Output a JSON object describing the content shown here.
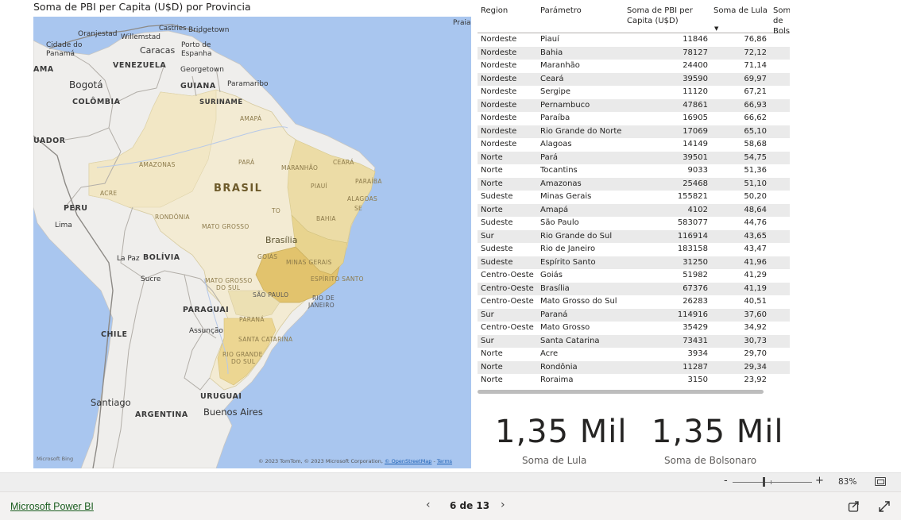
{
  "map": {
    "title": "Soma de PBI per Capita (U$D) por Provincia",
    "highlight_color": "#e8c973",
    "labels": {
      "country_brasil": "BRASIL",
      "country_venezuela": "VENEZUELA",
      "country_guiana": "GUIANA",
      "country_suriname": "SURINAME",
      "country_colombia": "COLÔMBIA",
      "country_equador": "UADOR",
      "country_peru": "PERU",
      "country_bolivia": "BOLÍVIA",
      "country_paraguai": "PARAGUAI",
      "country_chile": "CHILE",
      "country_argentina": "ARGENTINA",
      "country_uruguai": "URUGUAI",
      "city_oranjestad": "Oranjestad",
      "city_willemstad": "Willemstad",
      "city_castries": "Castries",
      "city_bridgetown": "Bridgetown",
      "city_cidade_panama_1": "Cidade do",
      "city_cidade_panama_2": "Panamá",
      "city_caracas": "Caracas",
      "city_porto_espanha_1": "Porto de",
      "city_porto_espanha_2": "Espanha",
      "city_georgetown": "Georgetown",
      "city_paramaribo": "Paramaribo",
      "city_bogota": "Bogotá",
      "city_lima": "Lima",
      "city_la_paz": "La Paz",
      "city_sucre": "Sucre",
      "city_assuncao": "Assunção",
      "city_santiago": "Santiago",
      "city_buenos_aires": "Buenos Aires",
      "city_brasilia": "Brasília",
      "city_praia": "Praia",
      "city_ama": "AMA",
      "state_amapa": "AMAPÁ",
      "state_amazonas": "AMAZONAS",
      "state_para": "PARÁ",
      "state_maranhao": "MARANHÃO",
      "state_ceara": "CEARÁ",
      "state_paraiba": "PARAÍBA",
      "state_piaui": "PIAUÍ",
      "state_acre": "ACRE",
      "state_alagoas": "ALAGOAS",
      "state_se": "SE",
      "state_to": "TO",
      "state_bahia": "BAHIA",
      "state_rondonia": "RONDÔNIA",
      "state_mato_grosso": "MATO GROSSO",
      "state_goias": "GOIÁS",
      "state_minas": "MINAS GERAIS",
      "state_espirito": "ESPÍRITO SANTO",
      "state_mgs_1": "MATO GROSSO",
      "state_mgs_2": "DO SUL",
      "state_sao_paulo": "SÃO PAULO",
      "state_rio_1": "RIO DE",
      "state_rio_2": "JANEIRO",
      "state_parana": "PARANÁ",
      "state_sc": "SANTA CATARINA",
      "state_rs_1": "RIO GRANDE",
      "state_rs_2": "DO SUL"
    },
    "attribution": "© 2023 TomTom, © 2023 Microsoft Corporation, ",
    "attribution_link": "© OpenStreetMap",
    "terms": "Terms",
    "bing": "Microsoft Bing"
  },
  "table": {
    "columns": {
      "region": "Region",
      "parametro": "Parámetro",
      "pbi": "Soma de PBI per Capita (U$D)",
      "lula": "Soma de Lula",
      "bols": "Soma de Bolsonaro"
    },
    "rows": [
      {
        "region": "Nordeste",
        "parametro": "Piauí",
        "pbi": "11846",
        "lula": "76,86"
      },
      {
        "region": "Nordeste",
        "parametro": "Bahia",
        "pbi": "78127",
        "lula": "72,12"
      },
      {
        "region": "Nordeste",
        "parametro": "Maranhão",
        "pbi": "24400",
        "lula": "71,14"
      },
      {
        "region": "Nordeste",
        "parametro": "Ceará",
        "pbi": "39590",
        "lula": "69,97"
      },
      {
        "region": "Nordeste",
        "parametro": "Sergipe",
        "pbi": "11120",
        "lula": "67,21"
      },
      {
        "region": "Nordeste",
        "parametro": "Pernambuco",
        "pbi": "47861",
        "lula": "66,93"
      },
      {
        "region": "Nordeste",
        "parametro": "Paraíba",
        "pbi": "16905",
        "lula": "66,62"
      },
      {
        "region": "Nordeste",
        "parametro": "Rio Grande do Norte",
        "pbi": "17069",
        "lula": "65,10"
      },
      {
        "region": "Nordeste",
        "parametro": "Alagoas",
        "pbi": "14149",
        "lula": "58,68"
      },
      {
        "region": "Norte",
        "parametro": "Pará",
        "pbi": "39501",
        "lula": "54,75"
      },
      {
        "region": "Norte",
        "parametro": "Tocantins",
        "pbi": "9033",
        "lula": "51,36"
      },
      {
        "region": "Norte",
        "parametro": "Amazonas",
        "pbi": "25468",
        "lula": "51,10"
      },
      {
        "region": "Sudeste",
        "parametro": "Minas Gerais",
        "pbi": "155821",
        "lula": "50,20"
      },
      {
        "region": "Norte",
        "parametro": "Amapá",
        "pbi": "4102",
        "lula": "48,64"
      },
      {
        "region": "Sudeste",
        "parametro": "São Paulo",
        "pbi": "583077",
        "lula": "44,76"
      },
      {
        "region": "Sur",
        "parametro": "Rio Grande do Sul",
        "pbi": "116914",
        "lula": "43,65"
      },
      {
        "region": "Sudeste",
        "parametro": "Rio de Janeiro",
        "pbi": "183158",
        "lula": "43,47"
      },
      {
        "region": "Sudeste",
        "parametro": "Espírito Santo",
        "pbi": "31250",
        "lula": "41,96"
      },
      {
        "region": "Centro-Oeste",
        "parametro": "Goiás",
        "pbi": "51982",
        "lula": "41,29"
      },
      {
        "region": "Centro-Oeste",
        "parametro": "Brasília",
        "pbi": "67376",
        "lula": "41,19"
      },
      {
        "region": "Centro-Oeste",
        "parametro": "Mato Grosso do Sul",
        "pbi": "26283",
        "lula": "40,51"
      },
      {
        "region": "Sur",
        "parametro": "Paraná",
        "pbi": "114916",
        "lula": "37,60"
      },
      {
        "region": "Centro-Oeste",
        "parametro": "Mato Grosso",
        "pbi": "35429",
        "lula": "34,92"
      },
      {
        "region": "Sur",
        "parametro": "Santa Catarina",
        "pbi": "73431",
        "lula": "30,73"
      },
      {
        "region": "Norte",
        "parametro": "Acre",
        "pbi": "3934",
        "lula": "29,70"
      },
      {
        "region": "Norte",
        "parametro": "Rondônia",
        "pbi": "11287",
        "lula": "29,34"
      },
      {
        "region": "Norte",
        "parametro": "Roraima",
        "pbi": "3150",
        "lula": "23,92"
      }
    ]
  },
  "kpis": [
    {
      "value": "1,35 Mil",
      "label": "Soma de Lula"
    },
    {
      "value": "1,35 Mil",
      "label": "Soma de Bolsonaro"
    }
  ],
  "zoom": {
    "minus": "-",
    "plus": "+",
    "percent": "83%",
    "level": 0.83
  },
  "footer": {
    "brand": "Microsoft Power BI",
    "page_label": "6 de 13",
    "current_page": 6,
    "total_pages": 13
  }
}
